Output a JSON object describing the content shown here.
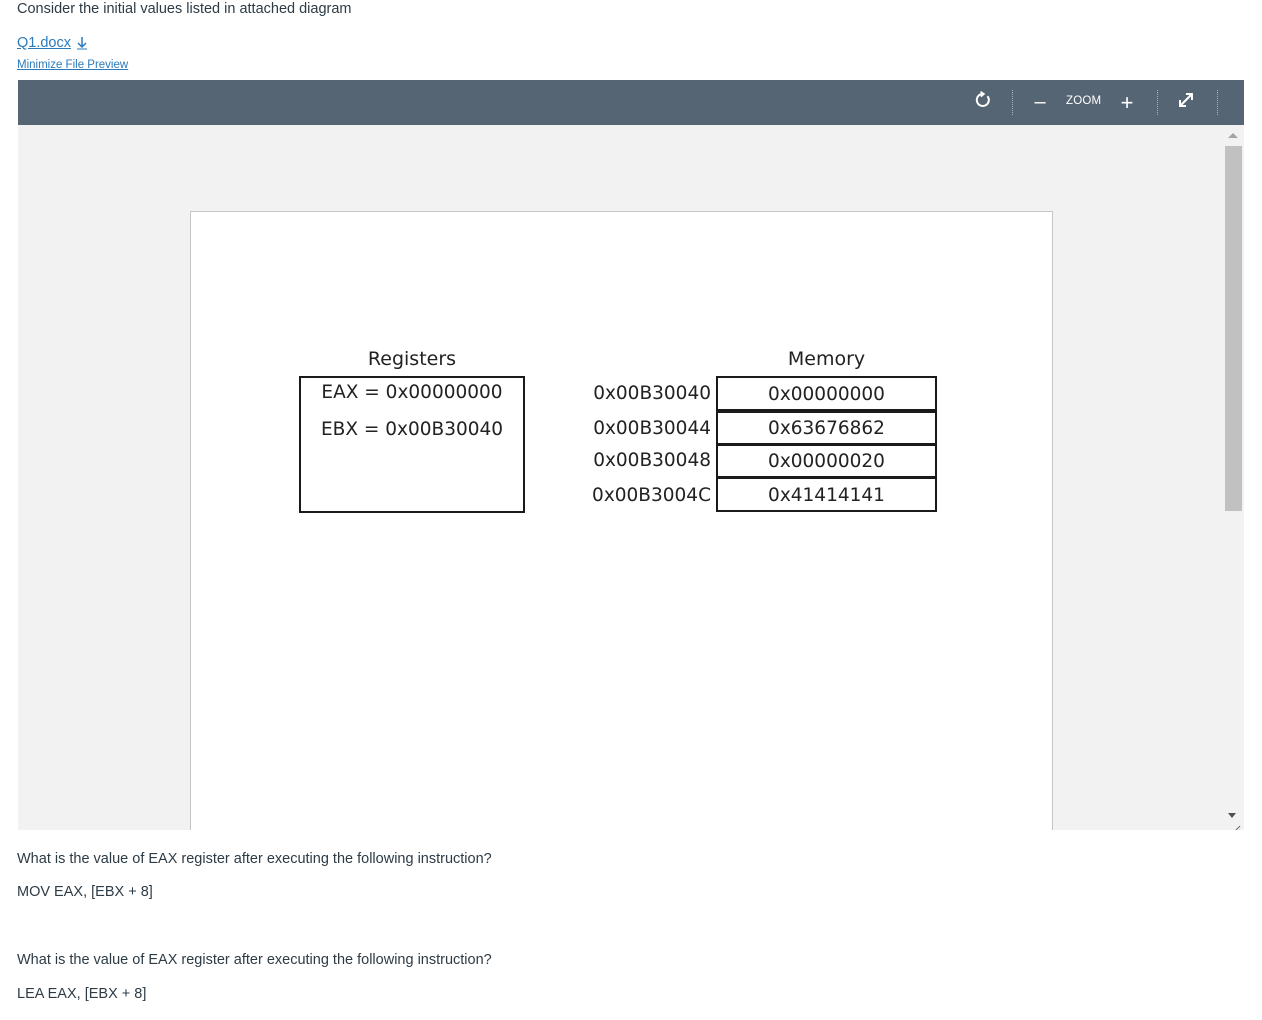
{
  "intro_text": "Consider the initial values listed in attached diagram",
  "file": {
    "name": "Q1.docx",
    "download_icon": "download-arrow-icon",
    "minimize_label": "Minimize File Preview"
  },
  "viewer": {
    "toolbar_color": "#566573",
    "rotate_icon": "rotate-icon",
    "zoom_out_label": "–",
    "zoom_label": "ZOOM",
    "zoom_in_label": "+",
    "fullscreen_icon": "expand-icon"
  },
  "diagram": {
    "registers_title": "Registers",
    "registers": [
      "EAX = 0x00000000",
      "EBX = 0x00B30040"
    ],
    "memory_title": "Memory",
    "memory": [
      {
        "address": "0x00B30040",
        "value": "0x00000000"
      },
      {
        "address": "0x00B30044",
        "value": "0x63676862"
      },
      {
        "address": "0x00B30048",
        "value": "0x00000020"
      },
      {
        "address": "0x00B3004C",
        "value": "0x41414141"
      }
    ]
  },
  "questions": [
    {
      "prompt": "What is the value of EAX register after executing the following instruction?",
      "instruction": "MOV EAX, [EBX + 8]"
    },
    {
      "prompt": "What is the value of EAX register after executing the following instruction?",
      "instruction": "LEA  EAX, [EBX + 8]"
    }
  ]
}
